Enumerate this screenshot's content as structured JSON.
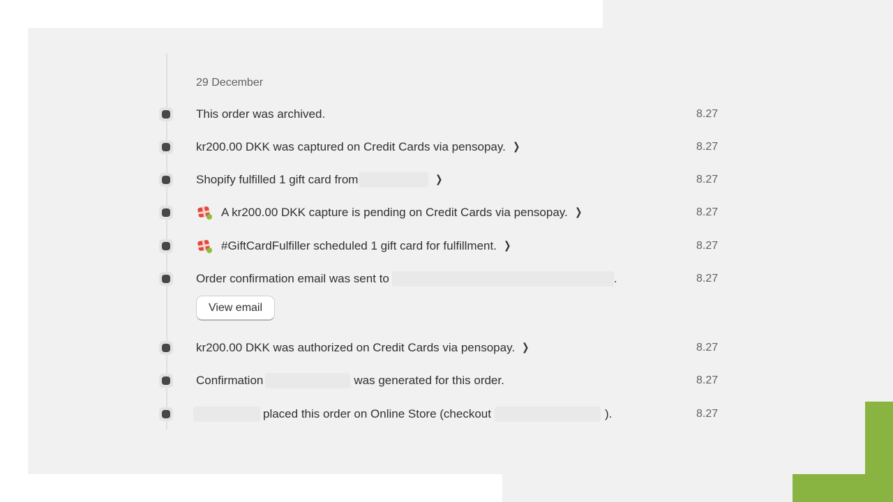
{
  "colors": {
    "panel_bg": "#f1f1f1",
    "frame_white": "#ffffff",
    "accent_green": "#8ab442",
    "dot": "#474747",
    "redacted": "#e9e9e9"
  },
  "timeline": {
    "date": "29 December",
    "events": [
      {
        "text": "This order was archived.",
        "time": "8.27"
      },
      {
        "text": "kr200.00 DKK was captured on Credit Cards via pensopay.",
        "time": "8.27",
        "chevron": "chevron-right-icon"
      },
      {
        "text": "Shopify fulfilled 1 gift card from",
        "time": "8.27",
        "chevron": "chevron-right-icon"
      },
      {
        "text": "A kr200.00 DKK capture is pending on Credit Cards via pensopay.",
        "time": "8.27",
        "icon": "gift-card-app-icon",
        "chevron": "chevron-right-icon"
      },
      {
        "text": "#GiftCardFulfiller scheduled 1 gift card for fulfillment.",
        "time": "8.27",
        "icon": "gift-card-app-icon",
        "chevron": "chevron-right-icon"
      },
      {
        "text_before": "Order confirmation email was sent to",
        "text_after": ".",
        "time": "8.27",
        "button": "View email"
      },
      {
        "text": "kr200.00 DKK was authorized on Credit Cards via pensopay.",
        "time": "8.27",
        "chevron": "chevron-right-icon"
      },
      {
        "text_before": "Confirmation",
        "text_after": "was generated for this order.",
        "time": "8.27"
      },
      {
        "text_before": "placed this order on Online Store (checkout",
        "text_after": ").",
        "time": "8.27"
      }
    ]
  }
}
